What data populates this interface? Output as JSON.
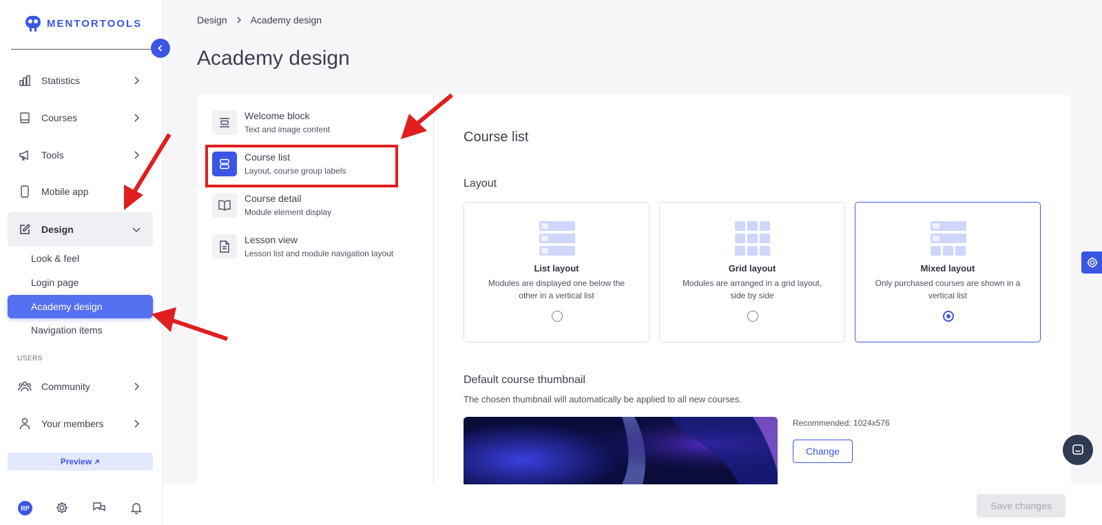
{
  "brand": {
    "name": "MENTORTOOLS",
    "accent": "#3a56e4",
    "annotation_color": "#e01e1e"
  },
  "sidebar": {
    "nav": [
      {
        "label": "Statistics",
        "icon": "bar-chart-icon"
      },
      {
        "label": "Courses",
        "icon": "book-icon"
      },
      {
        "label": "Tools",
        "icon": "megaphone-icon"
      },
      {
        "label": "Mobile app",
        "icon": "smartphone-icon"
      },
      {
        "label": "Design",
        "icon": "edit-icon",
        "expanded": true
      }
    ],
    "design_sub": [
      {
        "label": "Look & feel"
      },
      {
        "label": "Login page"
      },
      {
        "label": "Academy design",
        "selected": true
      },
      {
        "label": "Navigation items"
      }
    ],
    "users_section": "USERS",
    "users_nav": [
      {
        "label": "Community",
        "icon": "community-icon"
      },
      {
        "label": "Your members",
        "icon": "user-icon"
      }
    ],
    "preview_label": "Preview",
    "avatar_initials": "RP"
  },
  "breadcrumb": {
    "parent": "Design",
    "current": "Academy design"
  },
  "page_title": "Academy design",
  "settings_menu": [
    {
      "title": "Welcome block",
      "subtitle": "Text and image content",
      "icon": "welcome-block-icon"
    },
    {
      "title": "Course list",
      "subtitle": "Layout, course group labels",
      "icon": "course-list-icon",
      "selected": true
    },
    {
      "title": "Course detail",
      "subtitle": "Module element display",
      "icon": "open-book-icon"
    },
    {
      "title": "Lesson view",
      "subtitle": "Lesson list and module navigation layout",
      "icon": "document-icon"
    }
  ],
  "content": {
    "section_title": "Course list",
    "layout_label": "Layout",
    "layouts": [
      {
        "title": "List layout",
        "description": "Modules are displayed one below the other in a vertical list",
        "selected": false
      },
      {
        "title": "Grid layout",
        "description": "Modules are arranged in a grid layout, side by side",
        "selected": false
      },
      {
        "title": "Mixed layout",
        "description": "Only purchased courses are shown in a vertical list",
        "selected": true
      }
    ],
    "thumbnail_title": "Default course thumbnail",
    "thumbnail_description": "The chosen thumbnail will automatically be applied to all new courses.",
    "recommended": "Recommended: 1024x576",
    "change_label": "Change"
  },
  "footer": {
    "save_label": "Save changes",
    "save_enabled": false
  }
}
